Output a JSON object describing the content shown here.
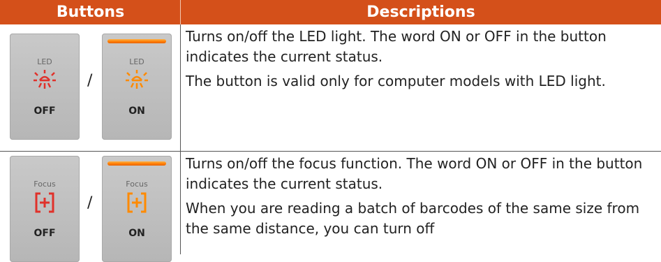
{
  "header": {
    "col1": "Buttons",
    "col2": "Descriptions"
  },
  "rows": [
    {
      "buttons": {
        "off": {
          "label": "LED",
          "state": "OFF"
        },
        "separator": "/",
        "on": {
          "label": "LED",
          "state": "ON"
        }
      },
      "desc": [
        "Turns on/off the LED light. The word ON or OFF in the button indicates the current status.",
        "The button is valid only for computer models with LED light."
      ]
    },
    {
      "buttons": {
        "off": {
          "label": "Focus",
          "state": "OFF"
        },
        "separator": "/",
        "on": {
          "label": "Focus",
          "state": "ON"
        }
      },
      "desc": [
        "Turns on/off the focus function. The word ON or OFF in the button indicates the current status.",
        "When you are reading a batch of barcodes of the same size from the same distance, you can turn off"
      ]
    }
  ],
  "colors": {
    "header_bg": "#d4501a",
    "accent_red": "#e0312a",
    "accent_orange": "#ff8a00"
  }
}
